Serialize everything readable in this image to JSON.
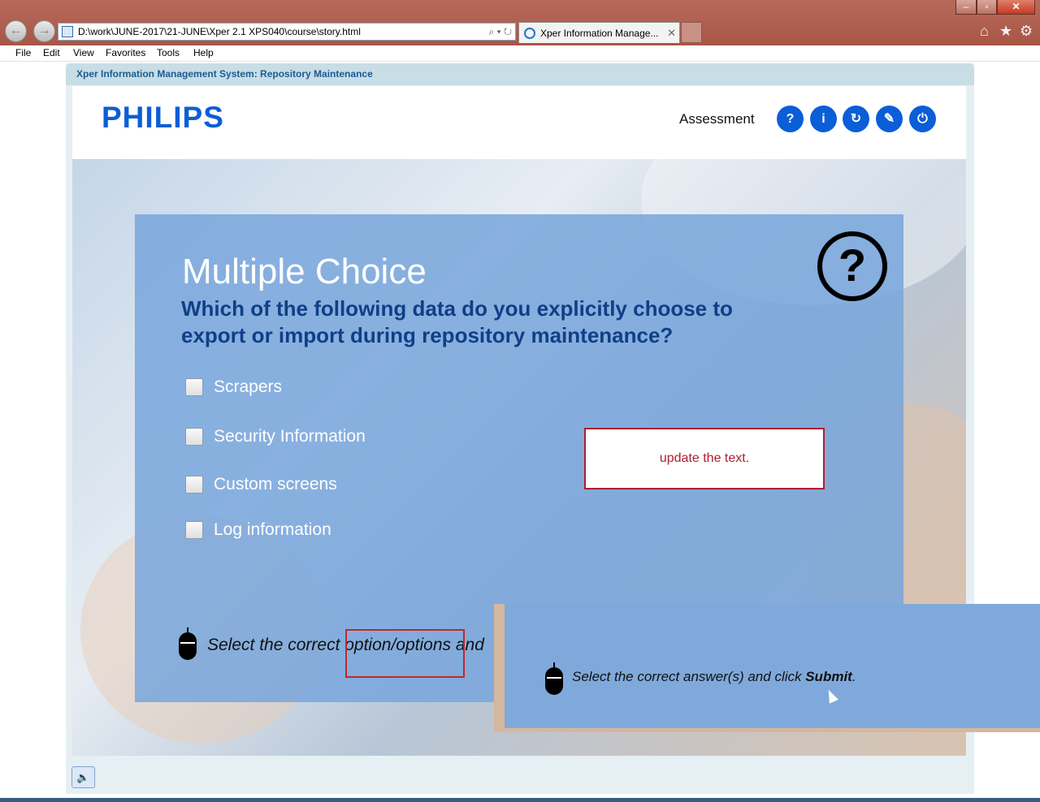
{
  "browser": {
    "address": "D:\\work\\JUNE-2017\\21-JUNE\\Xper 2.1 XPS040\\course\\story.html",
    "tab_title": "Xper Information Manage...",
    "back_icon": "back-arrow-icon",
    "forward_icon": "forward-arrow-icon"
  },
  "menu": {
    "file": "File",
    "edit": "Edit",
    "view": "View",
    "favorites": "Favorites",
    "tools": "Tools",
    "help": "Help"
  },
  "app": {
    "title": "Xper Information Management System: Repository Maintenance",
    "logo": "PHILIPS",
    "section": "Assessment"
  },
  "header_buttons": {
    "help": "?",
    "info": "i",
    "replay": "↻",
    "glossary": "✎",
    "exit": "⏻"
  },
  "question": {
    "heading": "Multiple Choice",
    "text": "Which of the following data do you explicitly choose to export or import during repository maintenance?",
    "options": [
      {
        "label": "Scrapers",
        "checked": false
      },
      {
        "label": "Security Information",
        "checked": false
      },
      {
        "label": "Custom screens",
        "checked": false
      },
      {
        "label": "Log information",
        "checked": false
      }
    ],
    "icon": "?"
  },
  "callout": {
    "text": "update the text."
  },
  "instructions": {
    "partial": "Select the correct option/options and",
    "full_prefix": "Select the correct answer(s) and click ",
    "full_bold": "Submit",
    "full_suffix": "."
  },
  "colors": {
    "accent": "#0b5ed7",
    "panel": "#78a6dc",
    "question_text": "#103f88",
    "callout_red": "#b01c2e"
  }
}
